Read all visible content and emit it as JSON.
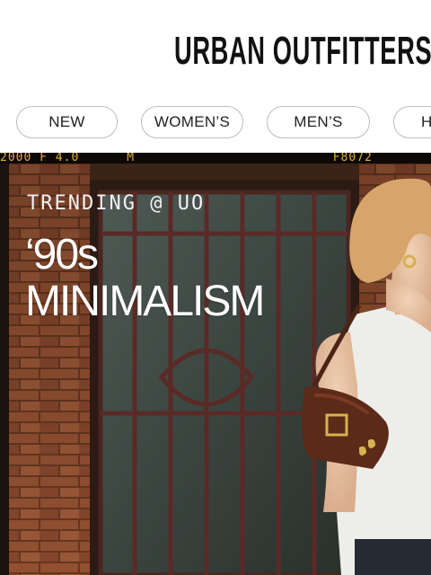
{
  "header": {
    "logo_text": "URBAN OUTFITTERS"
  },
  "nav": {
    "items": [
      {
        "label": "NEW"
      },
      {
        "label": "WOMEN’S"
      },
      {
        "label": "MEN’S"
      },
      {
        "label": "H"
      }
    ]
  },
  "hero": {
    "film_code": "2000 F 4.0      M                         F8072",
    "eyebrow": "TRENDING @ UO",
    "headline": "‘90s\nMINIMALISM"
  },
  "colors": {
    "brand_text": "#111111",
    "hero_text": "#ffffff",
    "pill_border": "#bdbdbd"
  },
  "icons": []
}
